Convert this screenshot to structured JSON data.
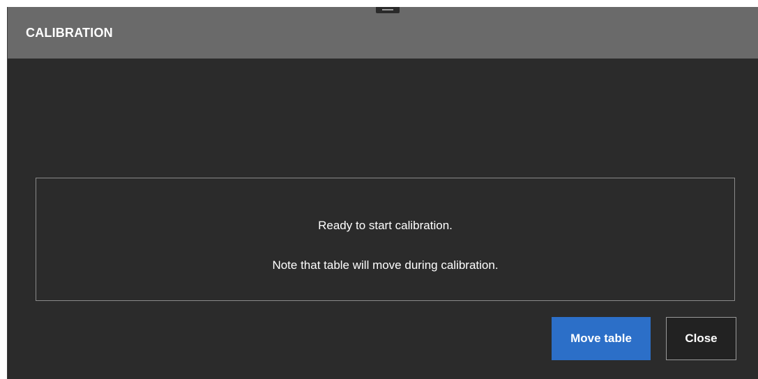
{
  "dialog": {
    "title": "CALIBRATION",
    "message_line_1": "Ready to start calibration.",
    "message_line_2": "Note that table will move during calibration."
  },
  "buttons": {
    "primary_label": "Move table",
    "secondary_label": "Close"
  },
  "colors": {
    "titlebar": "#6a6a6a",
    "body": "#2b2b2b",
    "primary_button": "#2c6fc8"
  }
}
